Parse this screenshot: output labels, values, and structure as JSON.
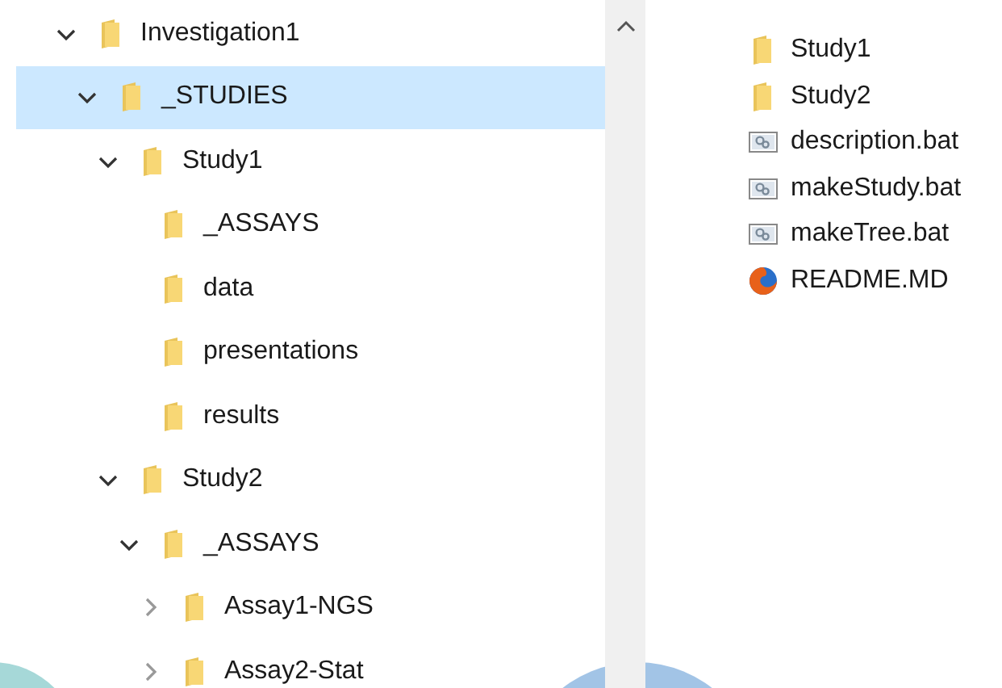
{
  "navigation_tree": [
    {
      "label": "Investigation1",
      "expanded": true,
      "selected": false,
      "children": [
        {
          "label": "_STUDIES",
          "expanded": true,
          "selected": true,
          "children": [
            {
              "label": "Study1",
              "expanded": true,
              "selected": false,
              "children": [
                {
                  "label": "_ASSAYS",
                  "selected": false
                },
                {
                  "label": "data",
                  "selected": false
                },
                {
                  "label": "presentations",
                  "selected": false
                },
                {
                  "label": "results",
                  "selected": false
                }
              ]
            },
            {
              "label": "Study2",
              "expanded": true,
              "selected": false,
              "children": [
                {
                  "label": "_ASSAYS",
                  "expanded": true,
                  "selected": false,
                  "children": [
                    {
                      "label": "Assay1-NGS",
                      "expanded": false,
                      "selected": false
                    },
                    {
                      "label": "Assay2-Stat",
                      "expanded": false,
                      "selected": false
                    }
                  ]
                }
              ]
            }
          ]
        }
      ]
    }
  ],
  "files": [
    {
      "name": "Study1",
      "kind": "folder"
    },
    {
      "name": "Study2",
      "kind": "folder"
    },
    {
      "name": "description.bat",
      "kind": "script"
    },
    {
      "name": "makeStudy.bat",
      "kind": "script"
    },
    {
      "name": "makeTree.bat",
      "kind": "script"
    },
    {
      "name": "README.MD",
      "kind": "web"
    }
  ]
}
